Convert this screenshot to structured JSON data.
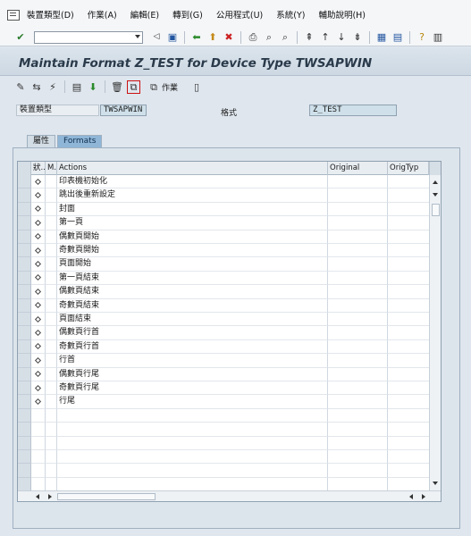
{
  "menu": {
    "items": [
      "裝置類型(D)",
      "作業(A)",
      "編輯(E)",
      "轉到(G)",
      "公用程式(U)",
      "系統(Y)",
      "輔助說明(H)"
    ]
  },
  "std_toolbar": {
    "command_field": "",
    "icons": [
      "enter-icon",
      "save-icon",
      "back-icon",
      "exit-icon",
      "cancel-icon",
      "print-icon",
      "find-icon",
      "find-next-icon",
      "first-page-icon",
      "prev-page-icon",
      "next-page-icon",
      "last-page-icon",
      "create-session-icon",
      "shortcut-icon",
      "help-icon",
      "layout-icon"
    ]
  },
  "title": "Maintain Format Z_TEST for Device Type TWSAPWIN",
  "app_toolbar": {
    "copy_action_label": "作業"
  },
  "form": {
    "device_type_label": "裝置類型",
    "device_type_value": "TWSAPWIN",
    "format_label": "格式",
    "format_value": "Z_TEST"
  },
  "tabs": [
    {
      "label": "屬性",
      "active": false
    },
    {
      "label": "Formats",
      "active": true
    }
  ],
  "table": {
    "columns": [
      "狀...",
      "M...",
      "Actions",
      "Original",
      "OrigTyp"
    ],
    "rows": [
      {
        "action": "印表機初始化"
      },
      {
        "action": "跳出後重新設定"
      },
      {
        "action": "封面"
      },
      {
        "action": "第一頁"
      },
      {
        "action": "偶數頁開始"
      },
      {
        "action": "奇數頁開始"
      },
      {
        "action": "頁面開始"
      },
      {
        "action": "第一頁結束"
      },
      {
        "action": "偶數頁結束"
      },
      {
        "action": "奇數頁結束"
      },
      {
        "action": "頁面結束"
      },
      {
        "action": "偶數頁行首"
      },
      {
        "action": "奇數頁行首"
      },
      {
        "action": "行首"
      },
      {
        "action": "偶數頁行尾"
      },
      {
        "action": "奇數頁行尾"
      },
      {
        "action": "行尾"
      }
    ],
    "empty_rows": 6
  },
  "colors": {
    "title_bg": "#cdd8e3",
    "active_tab": "#8fb6d7",
    "value_field": "#cfe0ea"
  }
}
